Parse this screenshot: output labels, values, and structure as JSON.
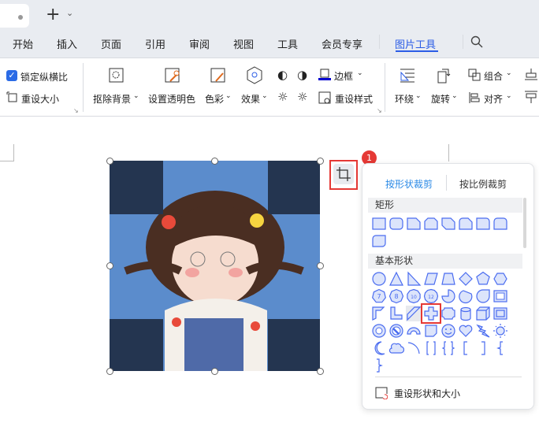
{
  "tabs": {
    "new_tab": "+",
    "dropdown": "⌄"
  },
  "menu": [
    "开始",
    "插入",
    "页面",
    "引用",
    "审阅",
    "视图",
    "工具",
    "会员专享",
    "图片工具"
  ],
  "ribbon": {
    "lock_ratio": "锁定纵横比",
    "reset_size": "重设大小",
    "remove_bg": "抠除背景",
    "set_transparent": "设置透明色",
    "color": "色彩",
    "effect": "效果",
    "border": "边框",
    "reset_style": "重设样式",
    "wrap": "环绕",
    "rotate": "旋转",
    "group": "组合",
    "align": "对齐"
  },
  "badge": "1",
  "panel": {
    "tab_shape": "按形状裁剪",
    "tab_ratio": "按比例裁剪",
    "section_rect": "矩形",
    "section_basic": "基本形状",
    "rect_shapes": [
      "rect",
      "round-rect",
      "snip1",
      "snip2-same",
      "snip2-diag",
      "round1-snip",
      "round1",
      "round2-same",
      "round-diag"
    ],
    "basic_shapes": [
      "oval",
      "triangle",
      "right-triangle",
      "parallelogram",
      "trapezoid",
      "diamond",
      "pentagon",
      "hexagon",
      "heptagon-7",
      "octagon-8",
      "decagon-10",
      "dodecagon-12",
      "pie",
      "chord",
      "teardrop",
      "frame",
      "half-frame",
      "l-shape",
      "diagonal-stripe",
      "plus",
      "plaque",
      "can",
      "cube",
      "bevel",
      "donut",
      "no-symbol",
      "block-arc",
      "folded-corner",
      "smiley",
      "heart",
      "lightning",
      "sun",
      "moon",
      "cloud",
      "arc",
      "bracket-pair",
      "brace-pair",
      "left-bracket",
      "right-bracket",
      "left-brace",
      "right-brace"
    ],
    "number_labels": {
      "heptagon-7": "7",
      "octagon-8": "8",
      "decagon-10": "10",
      "dodecagon-12": "12"
    },
    "selected_shape": "plus",
    "reset": "重设形状和大小"
  },
  "colors": {
    "accent": "#2b5ce6",
    "shape_fill": "#dce4fb",
    "shape_stroke": "#4a6cf0",
    "highlight": "#e53935"
  }
}
